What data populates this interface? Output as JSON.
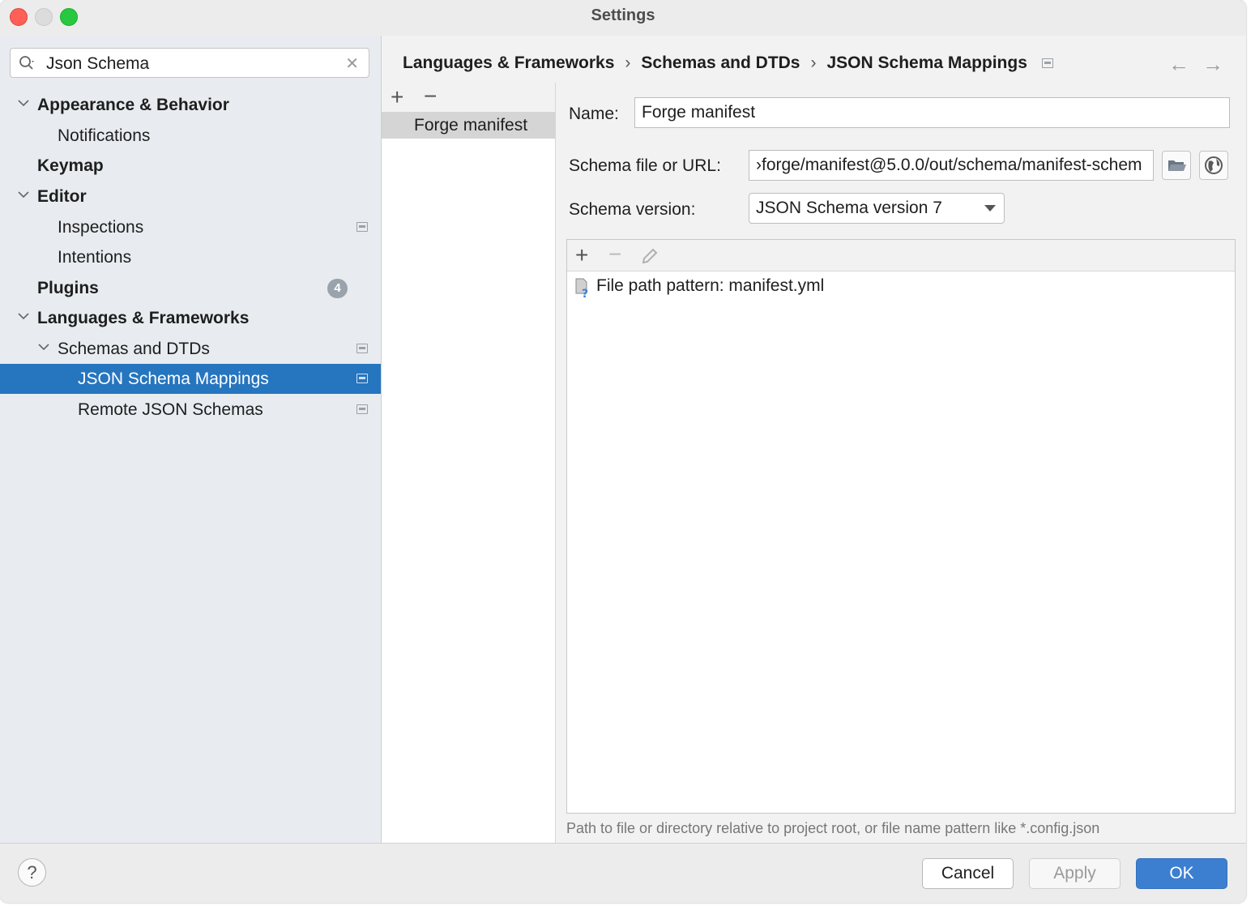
{
  "window": {
    "title": "Settings"
  },
  "sidebar": {
    "search": {
      "value": "Json Schema"
    },
    "items": [
      {
        "label": "Appearance & Behavior"
      },
      {
        "label": "Notifications"
      },
      {
        "label": "Keymap"
      },
      {
        "label": "Editor"
      },
      {
        "label": "Inspections"
      },
      {
        "label": "Intentions"
      },
      {
        "label": "Plugins",
        "badge": "4"
      },
      {
        "label": "Languages & Frameworks"
      },
      {
        "label": "Schemas and DTDs"
      },
      {
        "label": "JSON Schema Mappings",
        "selected": true
      },
      {
        "label": "Remote JSON Schemas"
      }
    ]
  },
  "breadcrumb": {
    "parts": [
      "Languages & Frameworks",
      "Schemas and DTDs",
      "JSON Schema Mappings"
    ],
    "separator": "›"
  },
  "mappings": {
    "items": [
      "Forge manifest"
    ]
  },
  "form": {
    "name_label": "Name:",
    "name_value": "Forge manifest",
    "schema_label": "Schema file or URL:",
    "schema_value": "›forge/manifest@5.0.0/out/schema/manifest-schem",
    "version_label": "Schema version:",
    "version_value": "JSON Schema version 7",
    "pattern_row": "File path pattern: manifest.yml",
    "hint": "Path to file or directory relative to project root, or file name pattern like *.config.json"
  },
  "footer": {
    "help": "?",
    "cancel": "Cancel",
    "apply": "Apply",
    "ok": "OK"
  },
  "colors": {
    "selection": "#2675bf",
    "ok_button": "#3c7fd1",
    "sidebar_bg": "#e8ecf0"
  }
}
